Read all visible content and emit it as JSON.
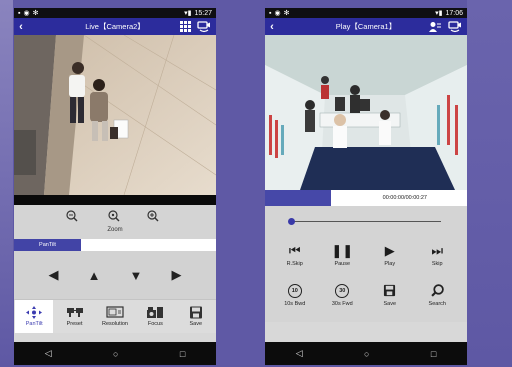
{
  "status_left": {
    "time": "15:27"
  },
  "status_right": {
    "time": "17:06"
  },
  "live": {
    "title": "Live【Camera2】",
    "back_icon": "back-arrow-icon",
    "zoom_label": "Zoom",
    "pantilt_tab": "PanTilt",
    "tabs": [
      {
        "label": "PanTilt",
        "icon": "pantilt-icon"
      },
      {
        "label": "Preset",
        "icon": "preset-icon"
      },
      {
        "label": "Resolution",
        "icon": "resolution-icon"
      },
      {
        "label": "Focus",
        "icon": "focus-icon"
      },
      {
        "label": "Save",
        "icon": "save-icon"
      }
    ]
  },
  "play": {
    "title": "Play【Camera1】",
    "timecode": "00:00:00/00:00:27",
    "row1": [
      {
        "label": "R.Skip",
        "icon": "rewind-skip-icon"
      },
      {
        "label": "Pause",
        "icon": "pause-icon"
      },
      {
        "label": "Play",
        "icon": "play-icon"
      },
      {
        "label": "Skip",
        "icon": "skip-icon"
      }
    ],
    "row2": [
      {
        "label": "10s Bwd",
        "icon": "10s-backward-icon",
        "num": "10"
      },
      {
        "label": "30s Fwd",
        "icon": "30s-forward-icon",
        "num": "30"
      },
      {
        "label": "Save",
        "icon": "save-icon"
      },
      {
        "label": "Search",
        "icon": "search-icon"
      }
    ]
  },
  "colors": {
    "header": "#2c2c9c",
    "accent": "#4244a6",
    "background": "#5e58a4"
  }
}
